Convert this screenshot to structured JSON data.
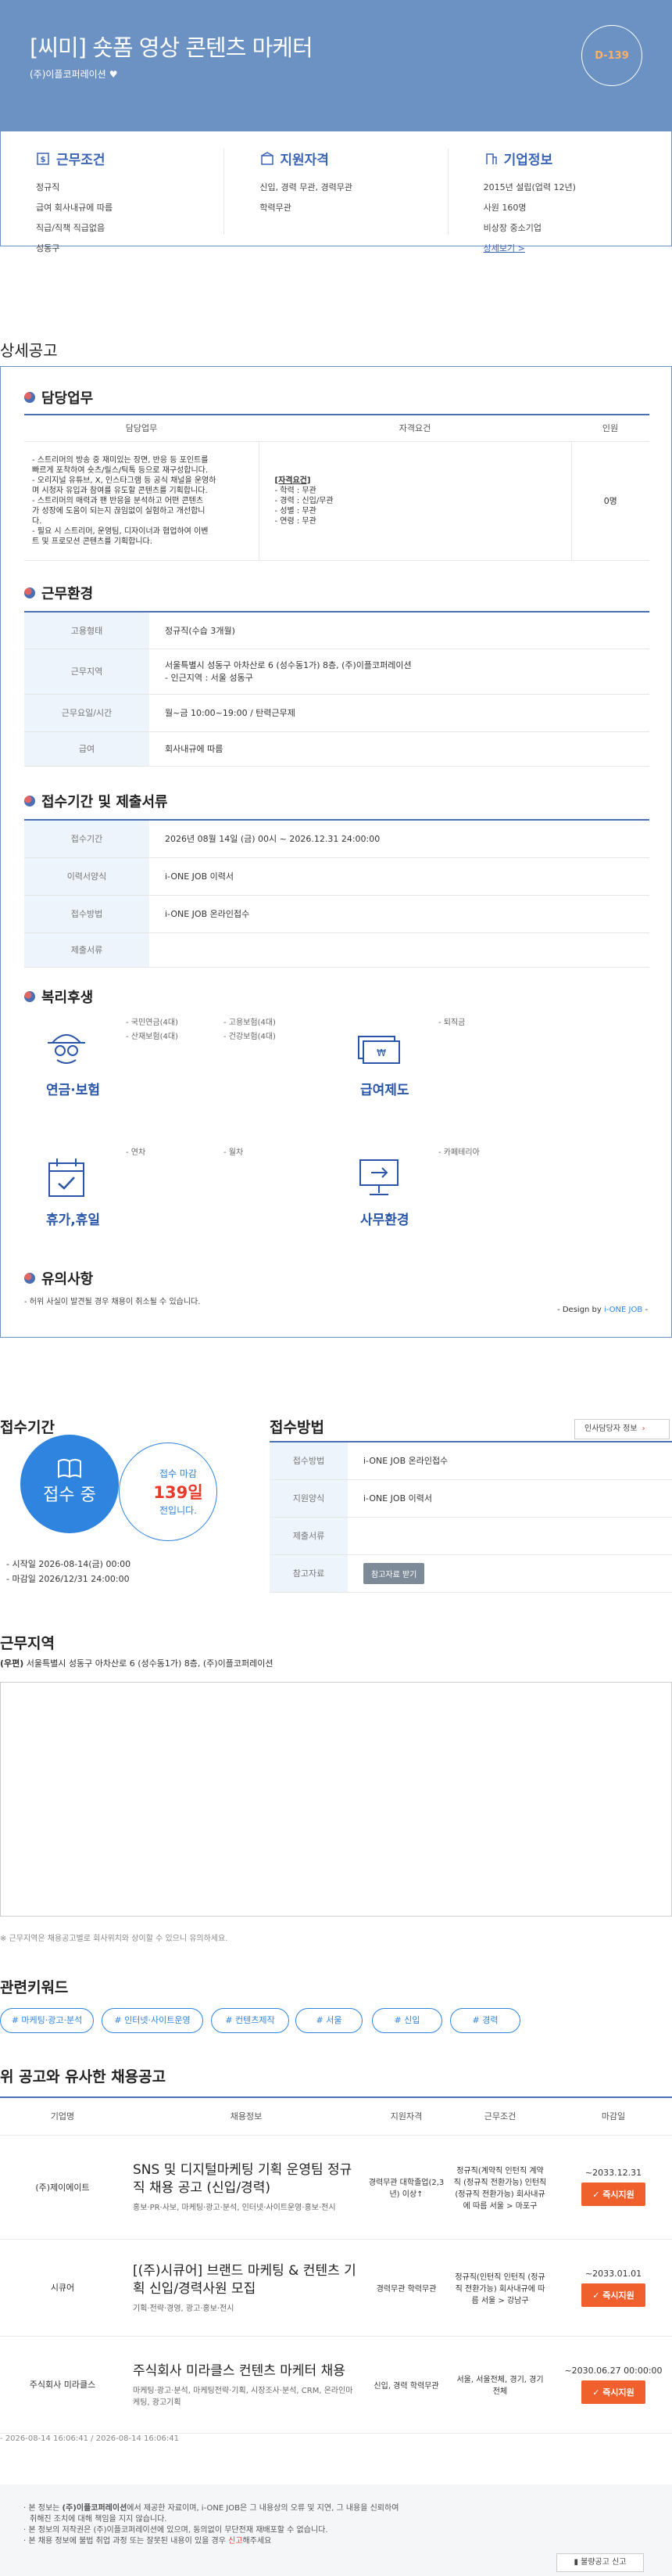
{
  "hero": {
    "title": "[씨미] 숏폼 영상 콘텐츠 마케터",
    "company": "(주)이플코퍼레이션",
    "dday": "D-139"
  },
  "summary": [
    {
      "title": "근무조건",
      "icon": "money-icon",
      "items": [
        "정규직",
        "급여 회사내규에 따름",
        "직급/직책 직급없음",
        "성동구"
      ]
    },
    {
      "title": "지원자격",
      "icon": "building-icon",
      "items": [
        "신입, 경력 무관, 경력무관",
        "학력무관"
      ]
    },
    {
      "title": "기업정보",
      "icon": "office-icon",
      "items": [
        "2015년 설립(업력 12년)",
        "사원 160명",
        "비상장 중소기업"
      ],
      "more": "상세보기 >"
    }
  ],
  "detail": {
    "section_title": "상세공고",
    "duty": {
      "title": "담당업무",
      "headers": [
        "담당업무",
        "자격요건",
        "인원"
      ],
      "duty_lines": [
        "- 스트리머의 방송 중 재미있는 장면, 반응 등 포인트를",
        "빠르게 포착하여 숏츠/릴스/틱톡 등으로 재구성합니다.",
        "- 오리지널 유튜브, X, 인스타그램 등 공식 채널을 운영하",
        "며 시청자 유입과 참여를 유도할 콘텐츠를 기획합니다.",
        "- 스트리머의 매력과 팬 반응을 분석하고 어떤 콘텐츠",
        "가 성장에 도움이 되는지 끊임없이 실험하고 개선합니",
        "다.",
        "- 필요 시 스트리머, 운영팀, 디자이너과 협업하여 이벤",
        "트 및 프로모션 콘텐츠를 기획합니다."
      ],
      "req_title": "[자격요건]",
      "req_lines": [
        "- 학력 : 무관",
        "- 경력 : 신입/무관",
        "- 성별 : 무관",
        "- 연령 : 무관"
      ],
      "count": "0명"
    },
    "env": {
      "title": "근무환경",
      "rows": [
        {
          "k": "고용형태",
          "v": "정규직(수습 3개월)"
        },
        {
          "k": "근무지역",
          "v": "서울특별시 성동구 아차산로 6 (성수동1가) 8층, (주)이플코퍼레이션",
          "v2": "- 인근지역 : 서울 성동구"
        },
        {
          "k": "근무요일/시간",
          "v": "월~금 10:00~19:00 / 탄력근무제"
        },
        {
          "k": "급여",
          "v": "회사내규에 따름"
        }
      ]
    },
    "period": {
      "title": "접수기간 및 제출서류",
      "rows": [
        {
          "k": "접수기간",
          "v": "2026년 08월 14일 (금) 00시 ~ 2026.12.31 24:00:00"
        },
        {
          "k": "이력서양식",
          "v": "i-ONE JOB 이력서"
        },
        {
          "k": "접수방법",
          "v": "i-ONE JOB 온라인접수"
        },
        {
          "k": "제출서류",
          "v": ""
        }
      ]
    },
    "welfare": {
      "title": "복리후생",
      "items": [
        {
          "name": "연금·보험",
          "icon": "face-icon",
          "col1": [
            "- 국민연금(4대)",
            "- 산재보험(4대)"
          ],
          "col2": [
            "- 고용보험(4대)",
            "- 건강보험(4대)"
          ]
        },
        {
          "name": "급여제도",
          "icon": "cash-icon",
          "col1": [
            "- 퇴직금"
          ],
          "col2": []
        },
        {
          "name": "휴가,휴일",
          "icon": "calendar-icon",
          "col1": [
            "- 연차"
          ],
          "col2": [
            "- 월차"
          ]
        },
        {
          "name": "사무환경",
          "icon": "monitor-icon",
          "col1": [
            "- 카페테리아"
          ],
          "col2": []
        }
      ]
    },
    "notice": {
      "title": "유의사항",
      "text": "- 허위 사실이 발견될 경우 채용이 취소될 수 있습니다.",
      "design_prefix": "- Design by ",
      "design_brand": "i-ONE JOB",
      "design_suffix": " -"
    }
  },
  "apply": {
    "period_title": "접수기간",
    "status": "접수 중",
    "deadline_label": "접수 마감",
    "days": "139일",
    "remaining": "전입니다.",
    "start": "- 시작일 2026-08-14(금) 00:00",
    "end": "- 마감일 2026/12/31 24:00:00",
    "method_title": "접수방법",
    "contact_button": "인사담당자 정보",
    "rows": [
      {
        "k": "접수방법",
        "v": "i-ONE JOB 온라인접수"
      },
      {
        "k": "지원양식",
        "v": "i-ONE JOB 이력서"
      },
      {
        "k": "제출서류",
        "v": ""
      },
      {
        "k": "참고자료",
        "v": ""
      }
    ],
    "ref_button": "참고자료 받기"
  },
  "location": {
    "title": "근무지역",
    "tag": "(우편)",
    "address": "서울특별시 성동구 아차산로 6 (성수동1가) 8층, (주)이플코퍼레이션",
    "note": "※ 근무지역은 채용공고별로 회사위치와 상이할 수 있으니 유의하세요."
  },
  "keywords": {
    "title": "관련키워드",
    "items": [
      "# 마케팅·광고·분석",
      "# 인터넷·사이트운영",
      "# 컨텐츠제작",
      "# 서울",
      "# 신입",
      "# 경력"
    ]
  },
  "similar": {
    "title": "위 공고와 유사한 채용공고",
    "headers": [
      "기업명",
      "채용정보",
      "지원자격",
      "근무조건",
      "마감일"
    ],
    "rows": [
      {
        "company": "(주)제이에이트",
        "title": "SNS 및 디지털마케팅 기획 운영팀 정규직 채용 공고 (신입/경력)",
        "tags": "홍보·PR·사보, 마케팅·광고·분석, 인터넷·사이트운영·홍보·전시",
        "qual": "경력무관 대학졸업(2,3년) 이상↑",
        "cond": "정규직(계약직 인턴직 계약직 (정규직 전환가능) 인턴직 (정규직 전환가능) 회사내규에 따름 서울 > 마포구",
        "deadline": "~2033.12.31",
        "btn": "✓ 즉시지원"
      },
      {
        "company": "시큐어",
        "title": "[(주)시큐어] 브랜드 마케팅 & 컨텐츠 기획 신입/경력사원 모집",
        "tags": "기획·전략·경영, 광고·홍보·전시",
        "qual": "경력무관 학력무관",
        "cond": "정규직(인턴직 인턴직 (정규직 전환가능) 회사내규에 따름 서울 > 강남구",
        "deadline": "~2033.01.01",
        "btn": "✓ 즉시지원"
      },
      {
        "company": "주식회사 미라클스",
        "title": "주식회사 미라클스 컨텐츠 마케터 채용",
        "tags": "마케팅·광고·분석, 마케팅전략·기획, 시장조사·분석, CRM, 온라인마케팅, 광고기획",
        "qual": "신입, 경력 학력무관",
        "cond": "서울, 서울전체, 경기, 경기전체",
        "deadline": "~2030.06.27 00:00:00",
        "btn": "✓ 즉시지원"
      }
    ],
    "timestamp": "- 2026-08-14 16:06:41 / 2026-08-14 16:06:41"
  },
  "footer": {
    "line1_prefix": "본 정보는 ",
    "line1_company": "(주)이플코퍼레이션",
    "line1_suffix": "에서 제공한 자료이며, i-ONE JOB은 그 내용상의 오류 및 지연, 그 내용을 신뢰하여",
    "line1b": "취해진 조치에 대해 책임을 지지 않습니다.",
    "line2": "본 정보의 저작권은 (주)이플코퍼레이션에 있으며, 동의없이 무단전재 재배포할 수 없습니다.",
    "line3_prefix": "본 채용 정보에 불법 취업 과정 또는 잘못된 내용이 있을 경우 ",
    "line3_link": "신고",
    "line3_suffix": "해주세요",
    "report_button": "불량공고 신고"
  },
  "colors": {
    "accent": "#6c92c4",
    "primary": "#2f84e0",
    "apply": "#f0602c",
    "days": "#e8392b"
  }
}
